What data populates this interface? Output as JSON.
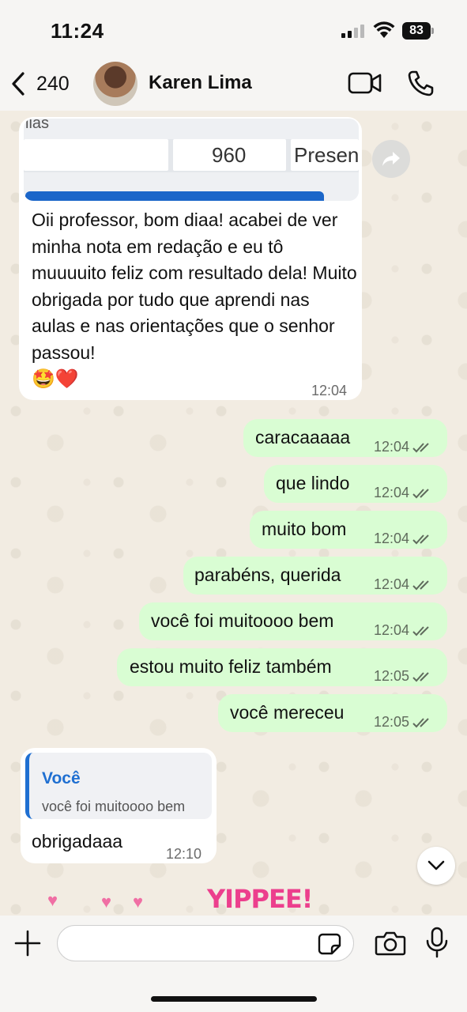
{
  "status": {
    "time": "11:24",
    "battery": "83"
  },
  "header": {
    "back_count": "240",
    "contact_name": "Karen Lima"
  },
  "messages": [
    {
      "direction": "in",
      "preview": {
        "top": "lias",
        "value": "960",
        "status": "Presen"
      },
      "text": "Oii professor, bom diaa! acabei de ver minha nota em redação e eu tô muuuuito feliz com resultado dela! Muito obrigada por tudo que aprendi nas aulas e nas orientações que o senhor passou!",
      "emoji": "🤩❤️",
      "time": "12:04"
    },
    {
      "direction": "out",
      "text": "caracaaaaa",
      "time": "12:04"
    },
    {
      "direction": "out",
      "text": "que lindo",
      "time": "12:04"
    },
    {
      "direction": "out",
      "text": "muito bom",
      "time": "12:04"
    },
    {
      "direction": "out",
      "text": "parabéns, querida",
      "time": "12:04"
    },
    {
      "direction": "out",
      "text": "você foi muitoooo bem",
      "time": "12:04"
    },
    {
      "direction": "out",
      "text": "estou muito feliz também",
      "time": "12:05"
    },
    {
      "direction": "out",
      "text": "você mereceu",
      "time": "12:05"
    },
    {
      "direction": "in",
      "reply": {
        "name": "Você",
        "text": "você foi muitoooo bem"
      },
      "text": "obrigadaaa",
      "time": "12:10"
    }
  ],
  "sticker": {
    "text": "YIPPEE!"
  },
  "composer": {
    "placeholder": ""
  },
  "colors": {
    "outgoing": "#d9fdd3",
    "incoming": "#ffffff",
    "accent": "#1f6fd1"
  }
}
